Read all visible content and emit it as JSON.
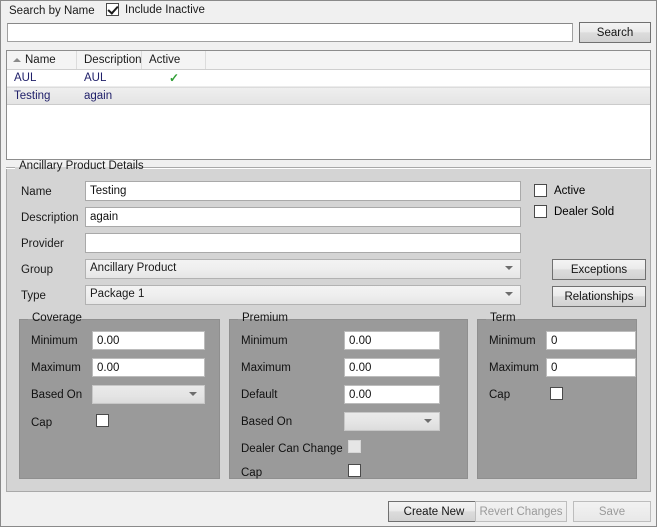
{
  "search": {
    "label": "Search by Name",
    "include_inactive_label": "Include Inactive",
    "include_inactive_checked": true,
    "input_value": "",
    "input_placeholder": "",
    "button_label": "Search"
  },
  "grid": {
    "columns": [
      "Name",
      "Description",
      "Active",
      ""
    ],
    "sort_column": "Name",
    "sort_direction": "asc",
    "rows": [
      {
        "name": "AUL",
        "description": "AUL",
        "active": "✓",
        "selected": false
      },
      {
        "name": "Testing",
        "description": "again",
        "active": "",
        "selected": true
      }
    ]
  },
  "details": {
    "legend": "Ancillary Product Details",
    "fields": {
      "name_label": "Name",
      "name_value": "Testing",
      "description_label": "Description",
      "description_value": "again",
      "provider_label": "Provider",
      "provider_value": "",
      "group_label": "Group",
      "group_value": "Ancillary Product",
      "type_label": "Type",
      "type_value": "Package 1"
    },
    "checkboxes": {
      "active_label": "Active",
      "active_checked": false,
      "dealer_sold_label": "Dealer Sold",
      "dealer_sold_checked": false
    },
    "buttons": {
      "exceptions": "Exceptions",
      "relationships": "Relationships"
    }
  },
  "coverage": {
    "legend": "Coverage",
    "minimum_label": "Minimum",
    "minimum_value": "0.00",
    "maximum_label": "Maximum",
    "maximum_value": "0.00",
    "based_on_label": "Based On",
    "based_on_value": "",
    "cap_label": "Cap",
    "cap_checked": false
  },
  "premium": {
    "legend": "Premium",
    "minimum_label": "Minimum",
    "minimum_value": "0.00",
    "maximum_label": "Maximum",
    "maximum_value": "0.00",
    "default_label": "Default",
    "default_value": "0.00",
    "based_on_label": "Based On",
    "based_on_value": "",
    "dealer_can_change_label": "Dealer Can Change",
    "dealer_can_change_checked": false,
    "dealer_can_change_disabled": true,
    "cap_label": "Cap",
    "cap_checked": false
  },
  "term": {
    "legend": "Term",
    "minimum_label": "Minimum",
    "minimum_value": "0",
    "maximum_label": "Maximum",
    "maximum_value": "0",
    "cap_label": "Cap",
    "cap_checked": false
  },
  "footer": {
    "create_new": "Create New",
    "revert_changes": "Revert Changes",
    "revert_changes_disabled": true,
    "save": "Save",
    "save_disabled": true
  },
  "colors": {
    "window_bg": "#f0f0f0",
    "panel_bg": "#d4d4d4",
    "subpanel_bg": "#9a9a9a",
    "grid_link_text": "#20206a",
    "active_check": "#2e9e33"
  }
}
